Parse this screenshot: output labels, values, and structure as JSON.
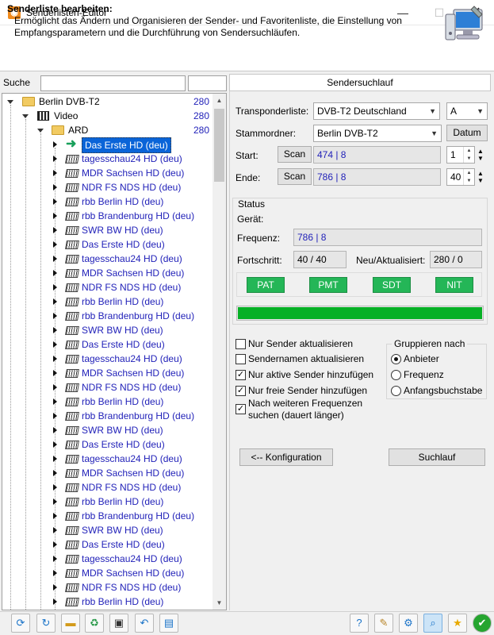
{
  "window": {
    "title": "Senderlisten-Editor"
  },
  "header": {
    "title": "Senderliste bearbeiten:",
    "description": "Ermöglicht das Ändern und Organisieren der Sender- und Favoritenliste, die Einstellung von Empfangsparametern und die Durchführung von Sendersuchläufen."
  },
  "search": {
    "label": "Suche",
    "value": ""
  },
  "tree": {
    "root": {
      "label": "Berlin DVB-T2",
      "count": "280"
    },
    "video": {
      "label": "Video",
      "count": "280"
    },
    "ard": {
      "label": "ARD",
      "count": "280"
    },
    "channels": [
      "Das Erste HD (deu)",
      "tagesschau24 HD (deu)",
      "MDR Sachsen HD (deu)",
      "NDR FS NDS HD (deu)",
      "rbb Berlin HD (deu)",
      "rbb Brandenburg HD (deu)",
      "SWR BW HD (deu)",
      "Das Erste HD (deu)",
      "tagesschau24 HD (deu)",
      "MDR Sachsen HD (deu)",
      "NDR FS NDS HD (deu)",
      "rbb Berlin HD (deu)",
      "rbb Brandenburg HD (deu)",
      "SWR BW HD (deu)",
      "Das Erste HD (deu)",
      "tagesschau24 HD (deu)",
      "MDR Sachsen HD (deu)",
      "NDR FS NDS HD (deu)",
      "rbb Berlin HD (deu)",
      "rbb Brandenburg HD (deu)",
      "SWR BW HD (deu)",
      "Das Erste HD (deu)",
      "tagesschau24 HD (deu)",
      "MDR Sachsen HD (deu)",
      "NDR FS NDS HD (deu)",
      "rbb Berlin HD (deu)",
      "rbb Brandenburg HD (deu)",
      "SWR BW HD (deu)",
      "Das Erste HD (deu)",
      "tagesschau24 HD (deu)",
      "MDR Sachsen HD (deu)",
      "NDR FS NDS HD (deu)",
      "rbb Berlin HD (deu)"
    ]
  },
  "scan": {
    "tab_label": "Sendersuchlauf",
    "transponder_label": "Transponderliste:",
    "transponder_value": "DVB-T2 Deutschland",
    "transponder_band": "A",
    "stammordner_label": "Stammordner:",
    "stammordner_value": "Berlin DVB-T2",
    "datum_button": "Datum",
    "start_label": "Start:",
    "start_scan_button": "Scan",
    "start_value": "474 | 8",
    "start_spin": "1",
    "ende_label": "Ende:",
    "ende_scan_button": "Scan",
    "ende_value": "786 | 8",
    "ende_spin": "40"
  },
  "status": {
    "title": "Status",
    "geraet_label": "Gerät:",
    "frequenz_label": "Frequenz:",
    "frequenz_value": "786 | 8",
    "fortschritt_label": "Fortschritt:",
    "fortschritt_value": "40 / 40",
    "neu_label": "Neu/Aktualisiert:",
    "neu_value": "280 / 0",
    "tables": [
      "PAT",
      "PMT",
      "SDT",
      "NIT"
    ],
    "progress_percent": 100,
    "progress_color": "#06b025"
  },
  "options": {
    "checkboxes": [
      {
        "label": "Nur Sender aktualisieren",
        "checked": false
      },
      {
        "label": "Sendernamen aktualisieren",
        "checked": false
      },
      {
        "label": "Nur aktive Sender hinzufügen",
        "checked": true
      },
      {
        "label": "Nur freie Sender hinzufügen",
        "checked": true
      },
      {
        "label": "Nach weiteren Frequenzen suchen (dauert länger)",
        "checked": true
      }
    ],
    "group_title": "Gruppieren nach",
    "radios": [
      {
        "label": "Anbieter",
        "checked": true
      },
      {
        "label": "Frequenz",
        "checked": false
      },
      {
        "label": "Anfangsbuchstabe",
        "checked": false
      }
    ]
  },
  "actions": {
    "config_button": "<-- Konfiguration",
    "suchlauf_button": "Suchlauf"
  },
  "toolbar": {
    "left_icons": [
      "refresh-icon",
      "refresh-all-icon",
      "new-folder-icon",
      "recycle-icon",
      "save-icon",
      "undo-icon",
      "screen-icon"
    ],
    "right_icons": [
      "help-icon",
      "edit-icon",
      "settings-icon",
      "search-scan-icon",
      "favorites-icon",
      "ok-icon"
    ]
  }
}
